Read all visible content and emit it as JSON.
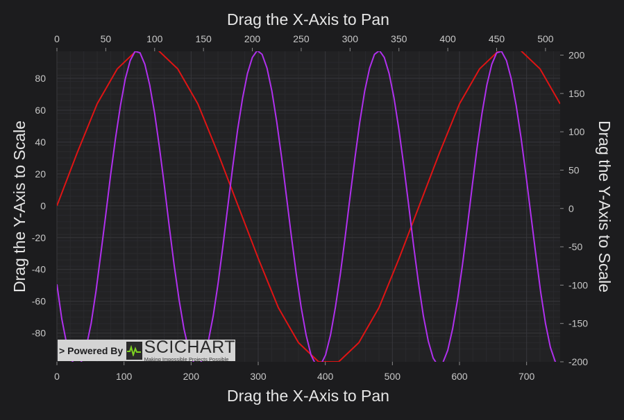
{
  "chart_data": {
    "type": "line",
    "x_axis_top": {
      "title": "Drag the X-Axis to Pan",
      "range": [
        0,
        515
      ],
      "ticks": [
        0,
        50,
        100,
        150,
        200,
        250,
        300,
        350,
        400,
        450,
        500
      ]
    },
    "x_axis_bottom": {
      "title": "Drag the X-Axis to Pan",
      "range": [
        0,
        750
      ],
      "ticks": [
        0,
        100,
        200,
        300,
        400,
        500,
        600,
        700
      ]
    },
    "y_axis_left": {
      "title": "Drag the Y-Axis to Scale",
      "range": [
        -98,
        97
      ],
      "ticks": [
        80,
        60,
        40,
        20,
        0,
        -20,
        -40,
        -60,
        -80
      ]
    },
    "y_axis_right": {
      "title": "Drag the Y-Axis to Scale",
      "range": [
        -200,
        205
      ],
      "ticks": [
        200,
        150,
        100,
        50,
        0,
        -50,
        -100,
        -150,
        -200
      ]
    },
    "grid": true,
    "series": [
      {
        "color": "#e01414",
        "x_axis": "bottom",
        "y_axis": "left",
        "x": [
          0,
          30,
          60,
          90,
          120,
          150,
          180,
          210,
          240,
          270,
          300,
          330,
          360,
          390,
          420,
          450,
          480,
          510,
          540,
          570,
          600,
          630,
          660,
          690,
          720,
          750
        ],
        "y": [
          0,
          33,
          64,
          86,
          98,
          98,
          86,
          64,
          33,
          0,
          -33,
          -64,
          -86,
          -98,
          -98,
          -86,
          -64,
          -33,
          0,
          33,
          64,
          86,
          98,
          98,
          86,
          64
        ]
      },
      {
        "color": "#b030ee",
        "x_axis": "top",
        "y_axis": "right",
        "x": [
          0,
          5,
          10,
          15,
          20,
          25,
          30,
          35,
          40,
          45,
          50,
          55,
          60,
          65,
          70,
          75,
          80,
          85,
          90,
          95,
          100,
          105,
          110,
          115,
          120,
          125,
          130,
          135,
          140,
          145,
          150,
          155,
          160,
          165,
          170,
          175,
          180,
          185,
          190,
          195,
          200,
          205,
          210,
          215,
          220,
          225,
          230,
          235,
          240,
          245,
          250,
          255,
          260,
          265,
          270,
          275,
          280,
          285,
          290,
          295,
          300,
          305,
          310,
          315,
          320,
          325,
          330,
          335,
          340,
          345,
          350,
          355,
          360,
          365,
          370,
          375,
          380,
          385,
          390,
          395,
          400,
          405,
          410,
          415,
          420,
          425,
          430,
          435,
          440,
          445,
          450,
          455,
          460,
          465,
          470,
          475,
          480,
          485,
          490,
          495,
          500,
          505,
          510,
          515
        ],
        "y": [
          -99,
          -144,
          -177,
          -198,
          -206,
          -200,
          -181,
          -150,
          -108,
          -59,
          -8,
          44,
          92,
          134,
          169,
          193,
          205,
          203,
          188,
          161,
          124,
          79,
          29,
          -24,
          -74,
          -119,
          -157,
          -185,
          -201,
          -205,
          -195,
          -173,
          -140,
          -97,
          -48,
          4,
          55,
          103,
          144,
          176,
          197,
          206,
          201,
          183,
          153,
          113,
          66,
          15,
          -37,
          -86,
          -129,
          -165,
          -191,
          -204,
          -204,
          -191,
          -165,
          -129,
          -86,
          -37,
          15,
          66,
          113,
          153,
          183,
          201,
          206,
          197,
          176,
          144,
          103,
          55,
          4,
          -48,
          -97,
          -140,
          -173,
          -195,
          -205,
          -201,
          -185,
          -157,
          -119,
          -74,
          -24,
          29,
          79,
          124,
          161,
          188,
          203,
          205,
          193,
          169,
          134,
          92,
          44,
          -8,
          -59,
          -108,
          -150,
          -181,
          -200,
          -206
        ]
      }
    ]
  },
  "logo": {
    "powered_by": "> Powered By",
    "brand": "SCICHART",
    "tagline": "Making Impossible Projects Possible"
  }
}
